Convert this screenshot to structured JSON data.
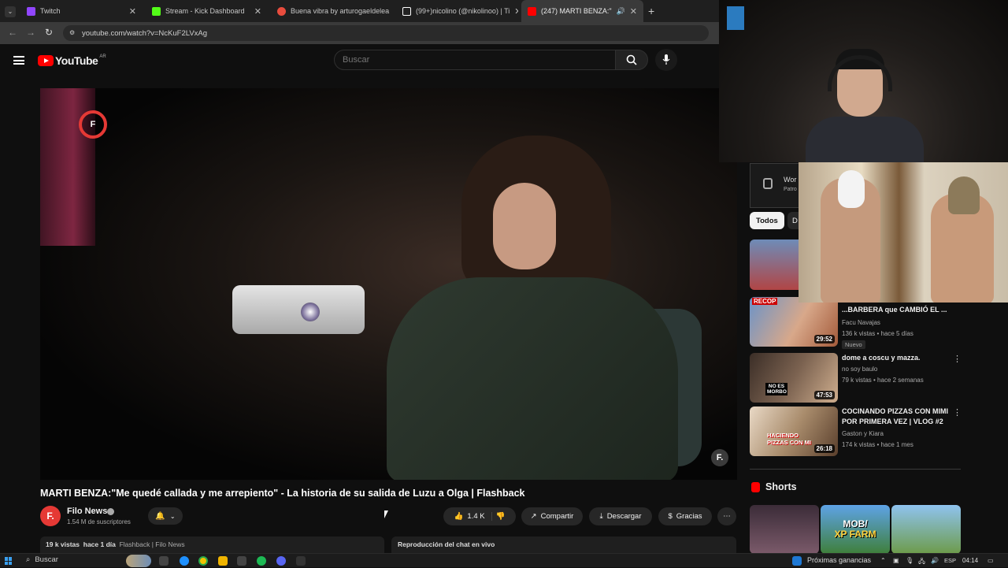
{
  "browser": {
    "tabs": [
      {
        "label": "Twitch",
        "color": "#9146ff"
      },
      {
        "label": "Stream - Kick Dashboard",
        "color": "#53fc18"
      },
      {
        "label": "Buena vibra by arturogaeldelea",
        "color": "#e84c3d"
      },
      {
        "label": "(99+)nicolino (@nikolinoo) | Ti",
        "color": "#ffffff"
      },
      {
        "label": "(247) MARTI BENZA:\"Me qu",
        "color": "#ff0000"
      }
    ],
    "url": "youtube.com/watch?v=NcKuF2LVxAg"
  },
  "header": {
    "logo_text": "YouTube",
    "region": "AR",
    "search_placeholder": "Buscar"
  },
  "video": {
    "watermark_letter": "F",
    "badge_letter": "F.",
    "title": "MARTI BENZA:\"Me quedé callada y me arrepiento\" - La historia de su salida de Luzu a Olga | Flashback"
  },
  "channel": {
    "avatar_letter": "F.",
    "name": "Filo News",
    "subscribers": "1.54 M de suscriptores"
  },
  "actions": {
    "likes": "1.4 K",
    "share": "Compartir",
    "download": "Descargar",
    "thanks": "Gracias"
  },
  "description": {
    "views": "19 k vistas",
    "date": "hace 1 día",
    "tags": "Flashback | Filo News"
  },
  "live_chat": "Reproducción del chat en vivo",
  "sidebar": {
    "card_title": "Wor",
    "card_sub": "Patro",
    "chips": [
      "Todos",
      "D"
    ],
    "items": [
      {
        "title": "...BARBERA que CAMBIÓ EL ...",
        "channel": "Facu Navajas",
        "meta": "136 k vistas • hace 5 días",
        "badge": "Nuevo",
        "duration": "29:52",
        "thumb_text": "RECOP"
      },
      {
        "title": "dome a coscu y mazza.",
        "channel": "no soy baulo",
        "meta": "79 k vistas • hace 2 semanas",
        "duration": "47:53",
        "thumb_text": "NO ES MORBO"
      },
      {
        "title": "COCINANDO PIZZAS CON MIMI POR PRIMERA VEZ | VLOG #2",
        "channel": "Gaston y Kiara",
        "meta": "174 k vistas • hace 1 mes",
        "duration": "26:18",
        "thumb_text": "HACIENDO PIZZAS CON MI"
      }
    ],
    "shorts_label": "Shorts",
    "shorts_text": [
      "MOB/",
      "XP FARM"
    ]
  },
  "taskbar": {
    "search": "Buscar",
    "earnings": "Próximas ganancias",
    "lang": "ESP",
    "time": "04:14"
  },
  "colors": {
    "bg": "#0f0f0f",
    "brand_red": "#ff0000"
  }
}
